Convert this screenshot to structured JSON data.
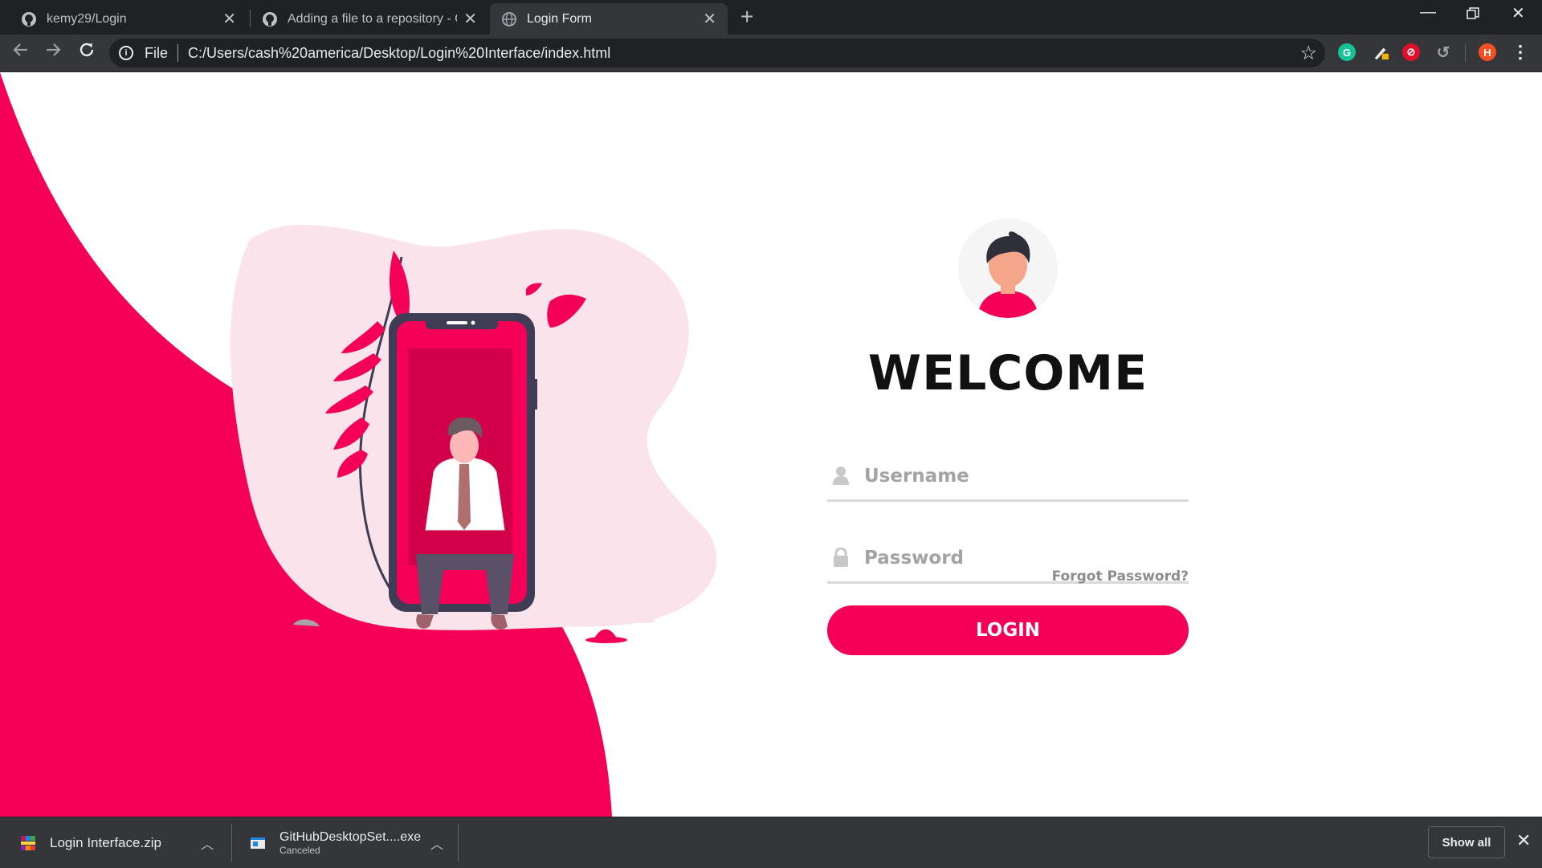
{
  "browser": {
    "tabs": [
      {
        "title": "kemy29/Login",
        "active": false,
        "favicon": "github-icon"
      },
      {
        "title": "Adding a file to a repository - GitHub",
        "active": false,
        "favicon": "github-icon"
      },
      {
        "title": "Login Form",
        "active": true,
        "favicon": "globe-icon"
      }
    ],
    "address": {
      "scheme_label": "File",
      "url": "C:/Users/cash%20america/Desktop/Login%20Interface/index.html"
    },
    "profile_initial": "H",
    "extensions": [
      "grammarly-icon",
      "pencil-icon",
      "adobe-icon",
      "history-icon"
    ]
  },
  "login": {
    "welcome": "WELCOME",
    "username_placeholder": "Username",
    "password_placeholder": "Password",
    "forgot_label": "Forgot Password?",
    "login_label": "LOGIN",
    "accent_color": "#f50057"
  },
  "downloads": {
    "items": [
      {
        "name": "Login Interface.zip",
        "status": ""
      },
      {
        "name": "GitHubDesktopSet....exe",
        "status": "Canceled"
      }
    ],
    "show_all_label": "Show all"
  }
}
